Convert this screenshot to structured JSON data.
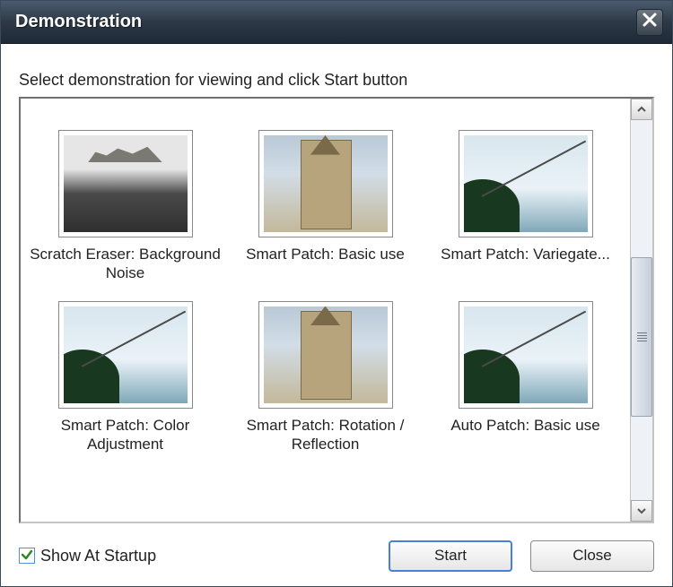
{
  "window": {
    "title": "Demonstration"
  },
  "instruction": "Select demonstration for viewing and click Start button",
  "demos": [
    {
      "label": "Scratch Eraser: Background Noise",
      "thumb": "noise"
    },
    {
      "label": "Smart Patch: Basic use",
      "thumb": "tower"
    },
    {
      "label": "Smart Patch: Variegate...",
      "thumb": "shore"
    },
    {
      "label": "Smart Patch: Color Adjustment",
      "thumb": "shore"
    },
    {
      "label": "Smart Patch: Rotation / Reflection",
      "thumb": "tower"
    },
    {
      "label": "Auto Patch: Basic use",
      "thumb": "shore"
    }
  ],
  "scrollbar": {
    "thumb_top_pct": 36,
    "thumb_height_pct": 42
  },
  "footer": {
    "show_at_startup_label": "Show At Startup",
    "show_at_startup_checked": true,
    "start_label": "Start",
    "close_label": "Close"
  }
}
